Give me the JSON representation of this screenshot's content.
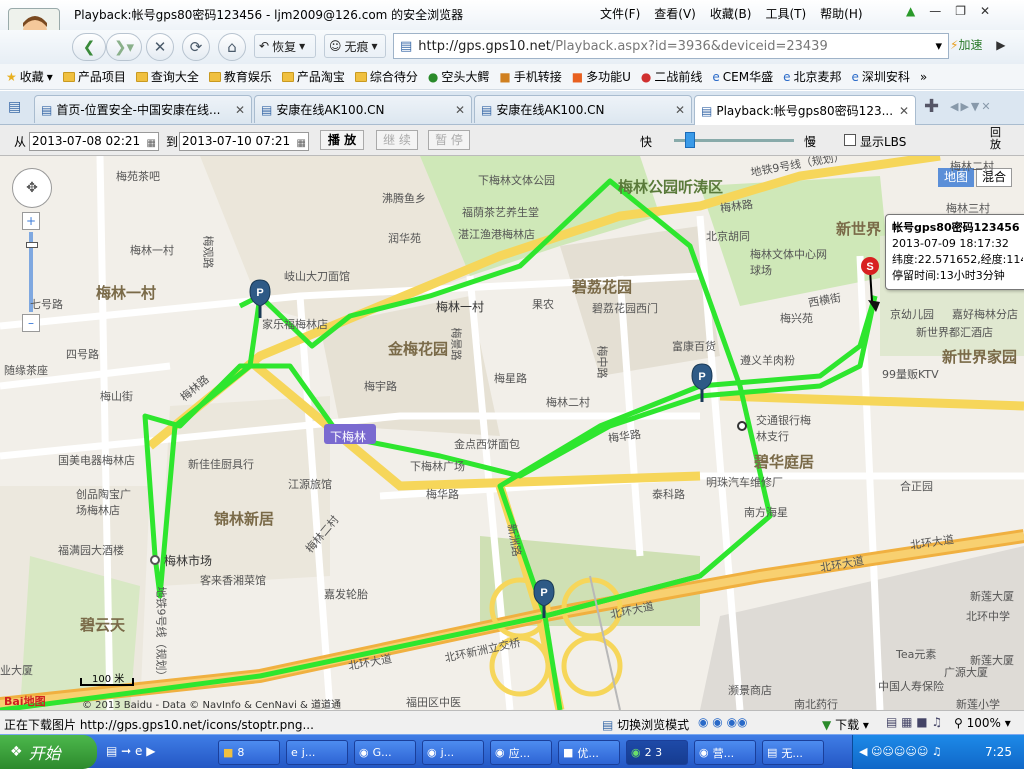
{
  "window": {
    "title": "Playback:帐号gps80密码123456 - ljm2009@126.com 的安全浏览器",
    "menus": [
      "文件(F)",
      "查看(V)",
      "收藏(B)",
      "工具(T)",
      "帮助(H)"
    ]
  },
  "nav": {
    "restore_label": "恢复",
    "private_label": "无痕",
    "url_domain": "http://gps.gps10.net",
    "url_path": "/Playback.aspx?id=3936&deviceid=23439",
    "speed_label": "加速"
  },
  "bookmarks": [
    "收藏",
    "产品项目",
    "查询大全",
    "教育娱乐",
    "产品淘宝",
    "综合待分",
    "空头大鳄",
    "手机转接",
    "多功能U",
    "二战前线",
    "CEM华盛",
    "北京麦邦",
    "深圳安科"
  ],
  "tabs": [
    {
      "label": "首页-位置安全-中国安康在线..."
    },
    {
      "label": "安康在线AK100.CN"
    },
    {
      "label": "安康在线AK100.CN"
    },
    {
      "label": "Playback:帐号gps80密码123..."
    }
  ],
  "controls": {
    "from_label": "从",
    "from_value": "2013-07-08 02:21",
    "to_label": "到",
    "to_value": "2013-07-10 07:21",
    "play_label": "播 放",
    "continue_label": "继 续",
    "pause_label": "暂 停",
    "fast_label": "快",
    "slow_label": "慢",
    "show_lbs_label": "显示LBS",
    "replay_label": "回放",
    "speed_level": 0.1
  },
  "map": {
    "type_map": "地图",
    "type_mixed": "混合",
    "scale_label": "100 米",
    "copyright": "© 2013 Baidu - Data © NavInfo & CenNavi & 道道通",
    "logo": "Bai地图",
    "labels": {
      "meilin_yicun_area": "梅林一村",
      "meilin_park": "梅林公园听涛区",
      "bilihuayuan": "碧荔花园",
      "jinmeihuayuan": "金梅花园",
      "jinlinxinju": "锦林新居",
      "bitingju": "碧云天",
      "biyutingju": "碧华庭居",
      "xinshijie": "新世界",
      "xinshijiejiayuan": "新世界家园",
      "meilin_shichang": "梅林市场",
      "xiameilin": "下梅林",
      "xiameilin_wenti": "下梅林文体公园",
      "beihuan_1": "北环大道",
      "beihuan_2": "北环大道",
      "beihuan_3": "北环大道",
      "beihuan_4": "北环大道",
      "xinzhou_jiaochaqiao": "北环新洲立交桥",
      "meihua_lu": "梅华路",
      "meihua_lu2": "梅华路",
      "meilin_lu": "梅林路",
      "xinzhou_lu": "新洲路",
      "meilin_ercun": "梅林二村",
      "meilin_yicun_small": "梅林一村",
      "meiyu_lu": "梅宇路",
      "meixing_lu": "梅星路",
      "meizhong_lu": "梅中路",
      "taike_lu": "泰科路",
      "meishan_jie": "梅山街",
      "qi_hao_lu": "七号路",
      "si_hao_lu": "四号路",
      "meilin_sancun": "梅林三村",
      "meilin_ercun_top": "梅林二村",
      "xiameilin_guangchang": "下梅林广场",
      "guomei": "国美电器梅林店",
      "chuangpin": "创品陶宝广场梅林店",
      "fumanyuan": "福满园大酒楼",
      "kejia": "客来香湘菜馆",
      "jiasheng": "嘉发轮胎",
      "xinjiayi": "新佳佳厨具行",
      "jiangyuan": "江源旅馆",
      "jinzhi": "金点西饼面包",
      "jiaotong": "交通银行梅林支行",
      "mingjie": "明珠汽车维修厂",
      "nanfang": "南方海星",
      "hezheng": "合正园",
      "fujia": "富康百货",
      "zunyi": "遵义羊肉粉",
      "meixing_yuan": "梅兴苑",
      "beijing_hutong": "北京胡同",
      "meilin_wenti": "梅林文体中心网球场",
      "fuyin": "福荫茶艺养生堂",
      "zhanjiang": "湛江渔港梅林店",
      "rushan": "润华苑",
      "feiteng": "沸腾鱼乡",
      "qishan": "岐山大刀面馆",
      "jiazhou": "家乐福梅林店",
      "meilin_yicun_station": "梅林一村",
      "guonong": "果农",
      "bilihuayuan_ximen": "碧荔花园西门",
      "xinshijie_dujiu": "新世界都汇酒店",
      "99ktv": "99量贩KTV",
      "jingshi": "京幼儿园",
      "jiayou": "嘉好梅林分店",
      "xiyuan_jie": "西横街",
      "beihuan_zhongxue": "北环中学",
      "xinlian_daxia": "新莲大厦",
      "xinlian_daxia2": "新莲大厦",
      "tea": "Tea元素",
      "guangyuan": "广源大厦",
      "zhongguo_renshou": "中国人寿保险",
      "xinlian_xiaoxue": "新莲小学",
      "shi_meng_shangdian": "濒景商店",
      "nanbei_yaodian": "南北药行",
      "futian_zhongyi": "福田区中医",
      "shiyan_ye": "业大厦",
      "meiyuan_chalou": "梅苑茶吧",
      "meilin_yicun_left": "梅林一村",
      "suiyuan": "随缘茶座",
      "ditie": "地铁9号线（规划）",
      "ditie2": "地铁9号线（规划）",
      "meilin_lu_sign": "梅林路",
      "meiguan_lu": "梅观路",
      "meijing_lu": "梅景路",
      "meilin_ercun_label": "梅林二村"
    }
  },
  "popup": {
    "account": "帐号gps80密码123456",
    "time": "2013-07-09 18:17:32",
    "coords": "纬度:22.571652,经度:114",
    "stay": "停留时间:13小时3分钟"
  },
  "status": {
    "loading": "正在下载图片 http://gps.gps10.net/icons/stoptr.png...",
    "switch_mode": "切换浏览模式",
    "download": "下载",
    "zoom": "100%"
  },
  "taskbar": {
    "start": "开始",
    "items": [
      "8",
      "j...",
      "G...",
      "j...",
      "应...",
      "优...",
      "2 3",
      "营...",
      "无..."
    ],
    "clock": "7:25"
  },
  "colors": {
    "track": "#2ee62e",
    "road_yellow": "#f6d65a",
    "road_main": "#f0b040",
    "park_green": "#cfe8b8",
    "block": "#e4dfd3",
    "pin_blue": "#2e5a86"
  }
}
